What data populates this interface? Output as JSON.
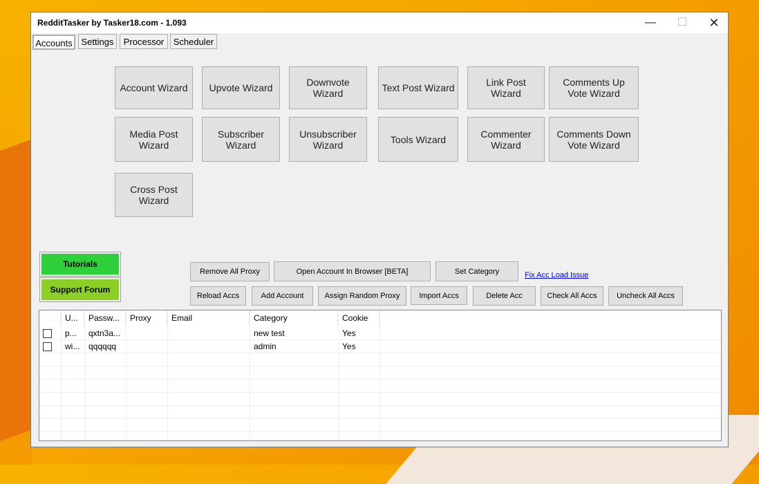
{
  "window": {
    "title": "RedditTasker by Tasker18.com - 1.093"
  },
  "tabs": [
    "Accounts",
    "Settings",
    "Processor",
    "Scheduler"
  ],
  "wizards": [
    "Account Wizard",
    "Upvote Wizard",
    "Downvote Wizard",
    "Text Post Wizard",
    "Link Post Wizard",
    "Comments Up Vote Wizard",
    "Media Post Wizard",
    "Subscriber Wizard",
    "Unsubscriber Wizard",
    "Tools Wizard",
    "Commenter Wizard",
    "Comments Down Vote Wizard",
    "Cross Post Wizard"
  ],
  "side": {
    "tutorials": "Tutorials",
    "support": "Support Forum"
  },
  "toolbar": {
    "remove_all_proxy": "Remove All Proxy",
    "open_browser": "Open Account In Browser [BETA]",
    "set_category": "Set Category",
    "fix_link": "Fix Acc Load Issue",
    "reload": "Reload Accs",
    "add": "Add Account",
    "assign_proxy": "Assign Random Proxy",
    "import": "Import Accs",
    "delete": "Delete Acc",
    "check_all": "Check All Accs",
    "uncheck_all": "Uncheck All Accs"
  },
  "table": {
    "columns": [
      "U...",
      "Passw...",
      "Proxy",
      "Email",
      "Category",
      "Cookie"
    ],
    "rows": [
      [
        "p...",
        "qxtn3a...",
        "",
        "",
        "new test",
        "Yes"
      ],
      [
        "wi...",
        "qqqqqq",
        "",
        "",
        "admin",
        "Yes"
      ]
    ]
  }
}
